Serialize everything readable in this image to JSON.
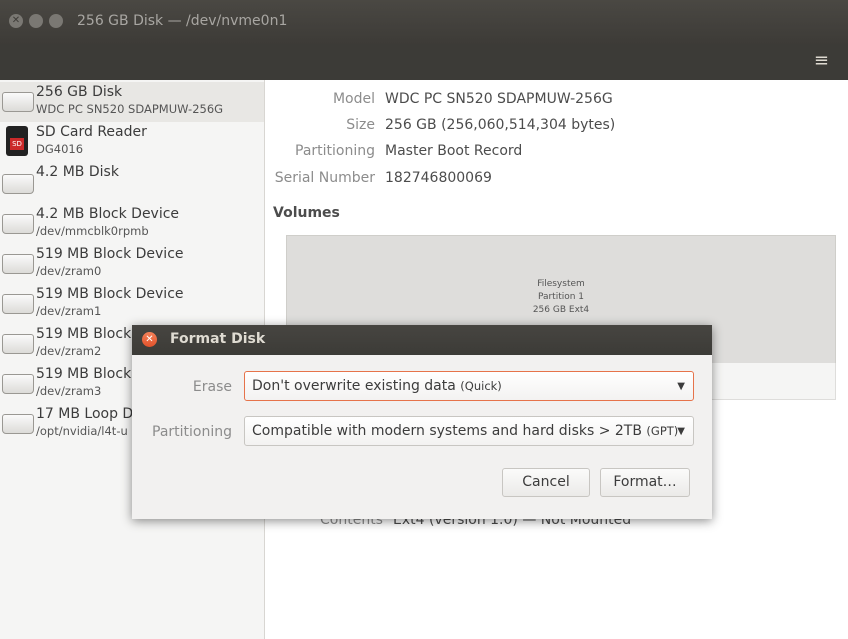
{
  "window": {
    "title": "256 GB Disk — /dev/nvme0n1",
    "menu_icon": "hamburger-menu-icon",
    "menu_glyph": "≡"
  },
  "sidebar": {
    "devices": [
      {
        "name": "256 GB Disk",
        "sub": "WDC PC SN520 SDAPMUW-256G",
        "icon": "hard-disk-icon",
        "selected": true
      },
      {
        "name": "SD Card Reader",
        "sub": "DG4016",
        "icon": "sd-card-icon"
      },
      {
        "name": "4.2 MB Disk",
        "sub": "",
        "icon": "hard-disk-icon"
      },
      {
        "name": "4.2 MB Block Device",
        "sub": "/dev/mmcblk0rpmb",
        "icon": "hard-disk-icon"
      },
      {
        "name": "519 MB Block Device",
        "sub": "/dev/zram0",
        "icon": "hard-disk-icon"
      },
      {
        "name": "519 MB Block Device",
        "sub": "/dev/zram1",
        "icon": "hard-disk-icon"
      },
      {
        "name": "519 MB Block",
        "sub": "/dev/zram2",
        "icon": "hard-disk-icon"
      },
      {
        "name": "519 MB Block",
        "sub": "/dev/zram3",
        "icon": "hard-disk-icon"
      },
      {
        "name": "17 MB Loop D",
        "sub": "/opt/nvidia/l4t-u",
        "icon": "hard-disk-icon"
      }
    ],
    "sd_badge": "SD"
  },
  "disk_info": {
    "model_label": "Model",
    "model_value": "WDC PC SN520 SDAPMUW-256G",
    "size_label": "Size",
    "size_value": "256 GB (256,060,514,304 bytes)",
    "partitioning_label": "Partitioning",
    "partitioning_value": "Master Boot Record",
    "serial_label": "Serial Number",
    "serial_value": "182746800069"
  },
  "volumes": {
    "title": "Volumes",
    "partition": {
      "line1": "Filesystem",
      "line2": "Partition 1",
      "line3": "256 GB Ext4"
    },
    "contents_label": "Contents",
    "contents_value": "Ext4 (version 1.0) — Not Mounted"
  },
  "dialog": {
    "title": "Format Disk",
    "close_glyph": "✕",
    "erase_label": "Erase",
    "erase_value": "Don't overwrite existing data",
    "erase_hint": "(Quick)",
    "partitioning_label": "Partitioning",
    "partitioning_value": "Compatible with modern systems and hard disks > 2TB",
    "partitioning_hint": "(GPT)",
    "dropdown_glyph": "▼",
    "cancel_label": "Cancel",
    "format_label": "Format…"
  },
  "colors": {
    "title_bar": "#3c3b37",
    "dialog_close": "#e2522b",
    "focus_border": "#e6734a"
  }
}
